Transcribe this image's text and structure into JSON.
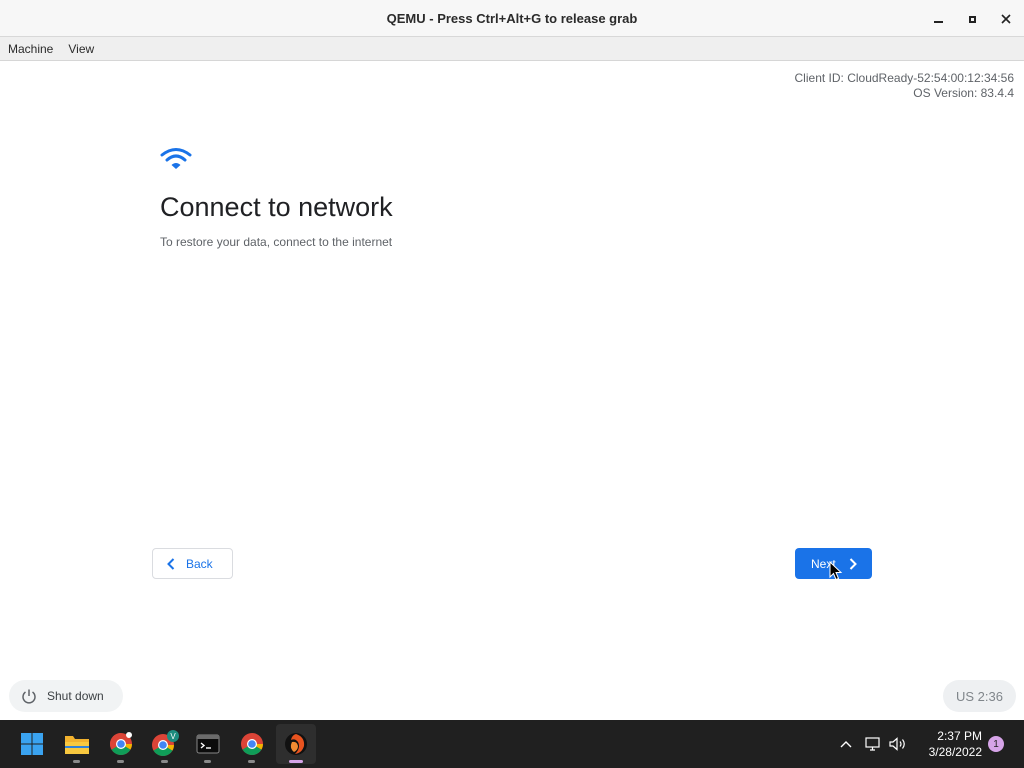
{
  "window": {
    "title": "QEMU - Press Ctrl+Alt+G to release grab",
    "controls": [
      "minimize",
      "maximize",
      "close"
    ]
  },
  "menu": {
    "items": [
      "Machine",
      "View"
    ]
  },
  "guest": {
    "client_id": "Client ID: CloudReady-52:54:00:12:34:56",
    "os_version": "OS Version: 83.4.4",
    "icon": "wifi-icon",
    "heading": "Connect to network",
    "subtext": "To restore your data, connect to the internet",
    "back_label": "Back",
    "next_label": "Next",
    "shutdown_label": "Shut down",
    "ime_label": "US 2:36",
    "accent_color": "#1a73e8"
  },
  "taskbar": {
    "apps": [
      "windows-start-icon",
      "file-explorer-icon",
      "chrome-profile-icon",
      "chrome-v-icon",
      "terminal-icon",
      "chrome-icon",
      "qemu-icon"
    ],
    "profile_badge": "V",
    "clock": {
      "time": "2:37 PM",
      "date": "3/28/2022"
    },
    "notification_count": "1"
  }
}
